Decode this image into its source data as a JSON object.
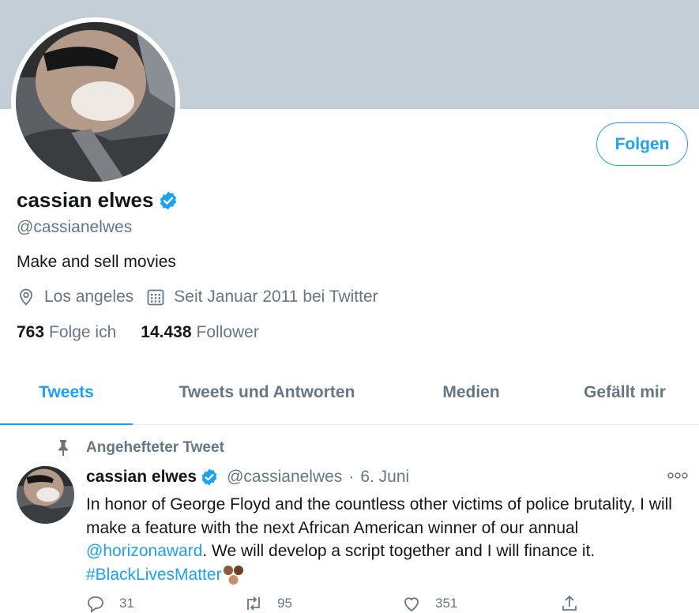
{
  "profile": {
    "display_name": "cassian elwes",
    "handle": "@cassianelwes",
    "bio": "Make and sell movies",
    "location": "Los angeles",
    "joined": "Seit Januar 2011 bei Twitter",
    "follow_label": "Folgen",
    "following_count": "763",
    "following_label": "Folge ich",
    "followers_count": "14.438",
    "followers_label": "Follower"
  },
  "tabs": [
    {
      "label": "Tweets",
      "active": true
    },
    {
      "label": "Tweets und Antworten",
      "active": false
    },
    {
      "label": "Medien",
      "active": false
    },
    {
      "label": "Gefällt mir",
      "active": false
    }
  ],
  "pinned_tweet": {
    "pinned_label": "Angehefteter Tweet",
    "author_name": "cassian elwes",
    "author_handle": "@cassianelwes",
    "separator": "·",
    "date": "6. Juni",
    "more_icon": "more-dots-icon",
    "text_part1": "In honor of George Floyd and the countless other victims of police brutality, I will make a feature with the next African American winner of our annual ",
    "mention": "@horizonaward",
    "text_part2": ". We will develop a script together and I will finance it.",
    "hashtag": "#BlackLivesMatter",
    "reply_count": "31",
    "retweet_count": "95",
    "like_count": "351"
  },
  "colors": {
    "accent": "#1da1f2",
    "banner": "#c4ced6",
    "secondary_text": "#657786"
  }
}
